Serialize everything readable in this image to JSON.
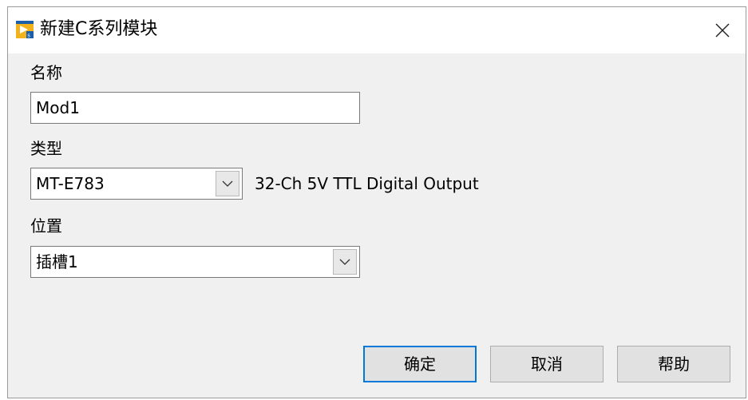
{
  "window": {
    "title": "新建C系列模块",
    "app_icon": "labview-project-icon",
    "close_icon": "close-icon"
  },
  "form": {
    "name": {
      "label": "名称",
      "value": "Mod1"
    },
    "type": {
      "label": "类型",
      "selected": "MT-E783",
      "description": "32-Ch 5V TTL Digital Output",
      "dropdown_icon": "chevron-down-icon"
    },
    "location": {
      "label": "位置",
      "selected": "插槽1",
      "dropdown_icon": "chevron-down-icon"
    }
  },
  "buttons": {
    "ok": "确定",
    "cancel": "取消",
    "help": "帮助"
  },
  "colors": {
    "dialog_bg": "#f0f0f0",
    "titlebar_bg": "#ffffff",
    "default_button_border": "#0078d7",
    "button_bg": "#e1e1e1"
  }
}
